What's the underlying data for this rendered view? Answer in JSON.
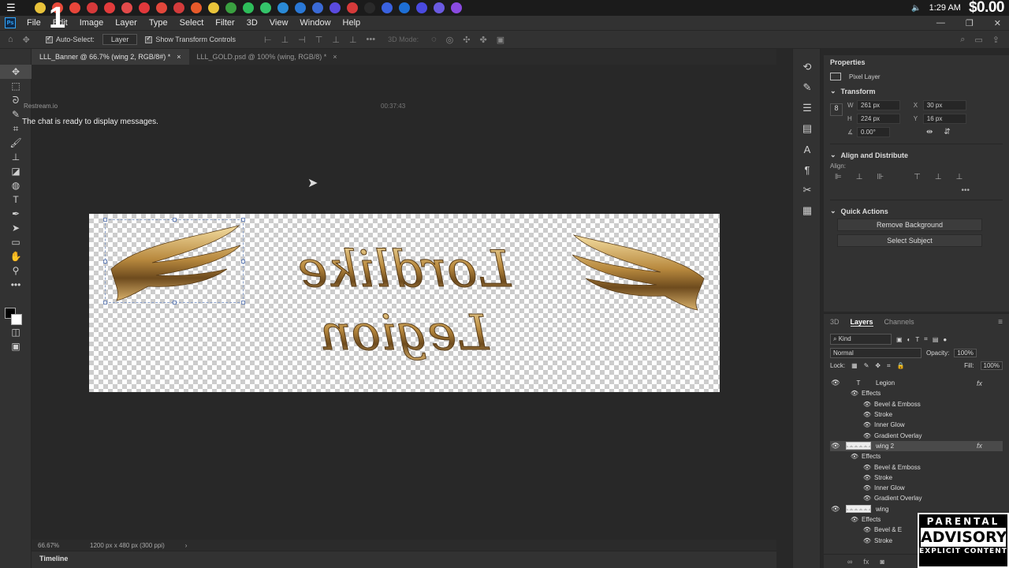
{
  "stream": {
    "number": "1",
    "balance": "$0.00"
  },
  "taskbar": {
    "time": "1:29 AM",
    "app_icons": [
      {
        "name": "app-icon-1",
        "color": "#e8c23a"
      },
      {
        "name": "app-icon-2",
        "color": "#e84a3a"
      },
      {
        "name": "app-icon-3",
        "color": "#e8463a"
      },
      {
        "name": "app-icon-4",
        "color": "#d6393a"
      },
      {
        "name": "app-icon-5",
        "color": "#e23b3b"
      },
      {
        "name": "app-icon-6",
        "color": "#e24a4a"
      },
      {
        "name": "app-icon-7",
        "color": "#e2383b"
      },
      {
        "name": "app-icon-8",
        "color": "#e2473b"
      },
      {
        "name": "app-icon-9",
        "color": "#d33b3b"
      },
      {
        "name": "app-icon-10",
        "color": "#e85a2a"
      },
      {
        "name": "app-icon-11",
        "color": "#e9c43a"
      },
      {
        "name": "app-icon-12",
        "color": "#3aa040"
      },
      {
        "name": "app-icon-13",
        "color": "#2ebd5a"
      },
      {
        "name": "app-icon-14",
        "color": "#34c46a"
      },
      {
        "name": "app-icon-15",
        "color": "#2a8ad6"
      },
      {
        "name": "app-icon-16",
        "color": "#2a78d6"
      },
      {
        "name": "app-icon-17",
        "color": "#3a6ad6"
      },
      {
        "name": "app-icon-18",
        "color": "#5a4ae0"
      },
      {
        "name": "app-icon-19",
        "color": "#d63a3a"
      },
      {
        "name": "app-icon-20",
        "color": "#2a2a2a"
      },
      {
        "name": "app-icon-21",
        "color": "#3a62e0"
      },
      {
        "name": "app-icon-22",
        "color": "#1d6fd6"
      },
      {
        "name": "app-icon-23",
        "color": "#4a4ae0"
      },
      {
        "name": "app-icon-24",
        "color": "#6a5ae0"
      },
      {
        "name": "app-icon-25",
        "color": "#8a4ae0"
      }
    ]
  },
  "menu": [
    "File",
    "Edit",
    "Image",
    "Layer",
    "Type",
    "Select",
    "Filter",
    "3D",
    "View",
    "Window",
    "Help"
  ],
  "options_bar": {
    "auto_select_label": "Auto-Select:",
    "auto_select_value": "Layer",
    "show_transform_label": "Show Transform Controls",
    "mode_3d": "3D Mode:"
  },
  "tabs": [
    {
      "label": "LLL_Banner @ 66.7% (wing 2, RGB/8#) *",
      "active": true
    },
    {
      "label": "LLL_GOLD.psd @ 100% (wing, RGB/8) *",
      "active": false
    }
  ],
  "chat": {
    "source": "Restream.io",
    "time": "00:37:43",
    "message": "The chat is ready to display messages."
  },
  "status": {
    "zoom": "66.67%",
    "doc_info": "1200 px x 480 px (300 ppi)"
  },
  "timeline_label": "Timeline",
  "properties": {
    "tab": "Properties",
    "kind": "Pixel Layer",
    "transform_title": "Transform",
    "w_label": "W",
    "w": "261 px",
    "h_label": "H",
    "h": "224 px",
    "x_label": "X",
    "x": "30 px",
    "y_label": "Y",
    "y": "16 px",
    "angle": "0.00°",
    "align_title": "Align and Distribute",
    "align_label": "Align:",
    "quick_title": "Quick Actions",
    "remove_bg": "Remove Background",
    "select_subject": "Select Subject"
  },
  "layers_panel": {
    "tabs": [
      "3D",
      "Layers",
      "Channels"
    ],
    "active_tab": "Layers",
    "kind": "Kind",
    "blend": "Normal",
    "opacity_label": "Opacity:",
    "opacity": "100%",
    "lock_label": "Lock:",
    "fill_label": "Fill:",
    "fill": "100%",
    "rows": [
      {
        "type": "layer",
        "icon": "T",
        "name": "Legion",
        "fx": true
      },
      {
        "type": "effects",
        "name": "Effects"
      },
      {
        "type": "effect",
        "name": "Bevel & Emboss"
      },
      {
        "type": "effect",
        "name": "Stroke"
      },
      {
        "type": "effect",
        "name": "Inner Glow"
      },
      {
        "type": "effect",
        "name": "Gradient Overlay"
      },
      {
        "type": "layer",
        "icon": "thumb",
        "name": "wing 2",
        "fx": true,
        "selected": true
      },
      {
        "type": "effects",
        "name": "Effects"
      },
      {
        "type": "effect",
        "name": "Bevel & Emboss"
      },
      {
        "type": "effect",
        "name": "Stroke"
      },
      {
        "type": "effect",
        "name": "Inner Glow"
      },
      {
        "type": "effect",
        "name": "Gradient Overlay"
      },
      {
        "type": "layer",
        "icon": "thumb",
        "name": "wing",
        "fx": false
      },
      {
        "type": "effects",
        "name": "Effects"
      },
      {
        "type": "effect",
        "name": "Bevel & E"
      },
      {
        "type": "effect",
        "name": "Stroke"
      }
    ]
  },
  "canvas_art": {
    "line1": "Lordlike",
    "line2": "Legion",
    "gold": "#c8a25a"
  },
  "advisory": {
    "line1": "PARENTAL",
    "line2": "ADVISORY",
    "line3": "EXPLICIT CONTENT"
  }
}
